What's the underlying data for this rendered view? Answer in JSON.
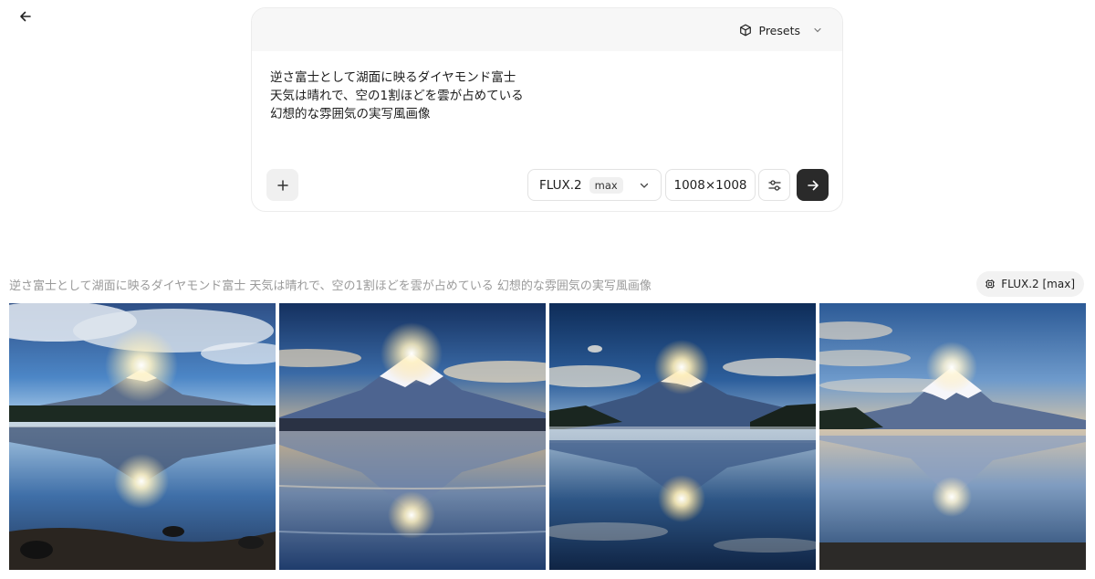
{
  "nav": {
    "back_icon": "arrow-left-icon"
  },
  "composer": {
    "presets_label": "Presets",
    "prompt_lines": [
      "逆さ富士として湖面に映るダイヤモンド富士",
      "天気は晴れで、空の1割ほどを雲が占めている",
      "幻想的な雰囲気の実写風画像"
    ],
    "model_name": "FLUX.2",
    "model_variant": "max",
    "size_label": "1008×1008"
  },
  "result": {
    "prompt_text": "逆さ富士として湖面に映るダイヤモンド富士 天気は晴れで、空の1割ほどを雲が占めている 幻想的な雰囲気の実写風画像",
    "model_badge": "FLUX.2 [max]",
    "image_count": 4
  },
  "colors": {
    "submit_bg": "#2a2a2a",
    "composer_header_bg": "#f7f7f7",
    "muted_text": "#9a9a9a"
  }
}
